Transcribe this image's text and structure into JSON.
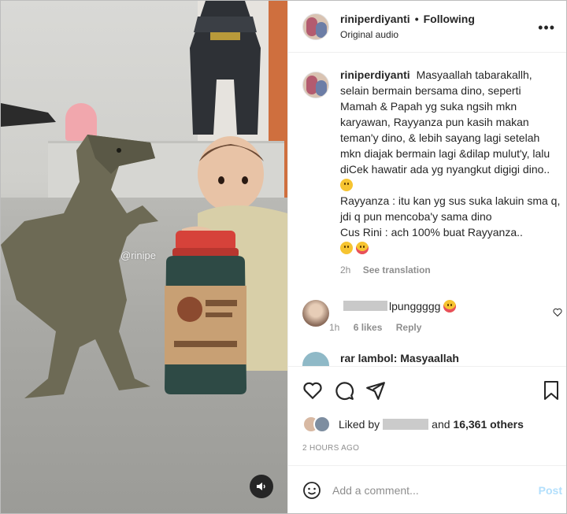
{
  "header": {
    "username": "riniperdiyanti",
    "separator": "•",
    "follow_status": "Following",
    "audio": "Original audio",
    "more": "•••"
  },
  "media": {
    "watermark": "@rinipe",
    "mute_icon": "speaker-muted-icon"
  },
  "caption": {
    "username": "riniperdiyanti",
    "text_1": "Masyaallah tabarakallh, selain bermain bersama dino, seperti Mamah & Papah yg suka ngsih mkn karyawan, Rayyanza pun kasih makan teman'y dino, & lebih sayang lagi setelah mkn diajak bermain lagi &dilap mulut'y, lalu diCek hawatir ada yg nyangkut digigi dino..",
    "text_2": "Rayyanza : itu kan yg sus suka lakuin sma q, jdi q pun mencoba'y sama dino",
    "text_3": "Cus Rini : ach 100% buat Rayyanza..",
    "time": "2h",
    "see_translation": "See translation"
  },
  "comments": [
    {
      "text": "lpunggggg",
      "time": "1h",
      "likes": "6 likes",
      "reply": "Reply"
    },
    {
      "text": "rar lambol: Masyaallah"
    }
  ],
  "actions": {
    "icons": [
      "heart-icon",
      "comment-icon",
      "share-icon",
      "bookmark-icon"
    ]
  },
  "likes": {
    "prefix": "Liked by",
    "mid": "and",
    "others": "16,361 others"
  },
  "timestamp": "2 HOURS AGO",
  "add_comment": {
    "placeholder": "Add a comment...",
    "post": "Post"
  },
  "colors": {
    "text": "#262626",
    "muted": "#8e8e8e",
    "post_disabled": "#b2dffc",
    "jar_lid": "#d6423a"
  }
}
